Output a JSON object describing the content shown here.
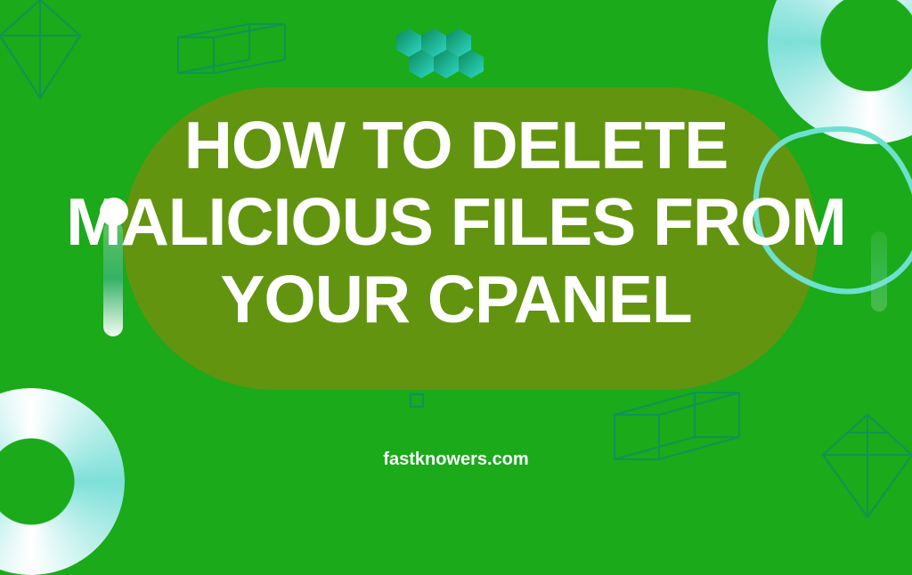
{
  "title": {
    "line1": "HOW TO DELETE",
    "line2": "MALICIOUS FILES FROM",
    "line3": "YOUR CPANEL"
  },
  "footer": "fastknowers.com"
}
